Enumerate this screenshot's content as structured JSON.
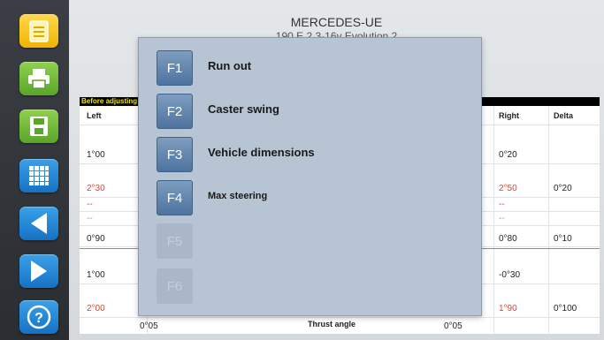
{
  "header": {
    "title": "MERCEDES-UE",
    "subtitle": "190 E 2.3-16v Evolution 2"
  },
  "sidebar": {
    "buttons": [
      {
        "icon": "notepad-icon",
        "color": "#f5c000"
      },
      {
        "icon": "printer-icon",
        "color": "#6ab83a"
      },
      {
        "icon": "save-icon",
        "color": "#6ab83a"
      },
      {
        "icon": "grid-icon",
        "color": "#1f86d6"
      },
      {
        "icon": "back-arrow-icon",
        "color": "#1f86d6"
      },
      {
        "icon": "forward-arrow-icon",
        "color": "#1f86d6"
      },
      {
        "icon": "help-icon",
        "color": "#1f86d6"
      }
    ]
  },
  "table": {
    "section_label": "Before adjusting",
    "col_left": "Left",
    "col_right": "Right",
    "col_delta": "Delta",
    "rows": {
      "r1_left": "1°00",
      "r1_right": "0°20",
      "r2_left": "2°30",
      "r2_right": "2°50",
      "r2_delta": "0°20",
      "r3_left": "--",
      "r3_right": "--",
      "r4_left": "--",
      "r4_right": "--",
      "r5_left": "0°90",
      "r5_right": "0°80",
      "r5_delta": "0°10",
      "r6_left": "1°00",
      "r6_right": "-0°30",
      "r7_left": "2°00",
      "r7_right": "1°90",
      "r7_delta": "0°100",
      "footer_left_value": "0°05",
      "footer_label": "Thrust angle",
      "footer_right_value": "0°05",
      "partial_c1": "(",
      "partial_c2": "(",
      "partial_c3": "(",
      "partial_r1": "-"
    }
  },
  "popup": {
    "items": [
      {
        "key": "F1",
        "label": "Run out",
        "enabled": true
      },
      {
        "key": "F2",
        "label": "Caster swing",
        "enabled": true
      },
      {
        "key": "F3",
        "label": "Vehicle dimensions",
        "enabled": true
      },
      {
        "key": "F4",
        "label": "Max steering",
        "enabled": true
      },
      {
        "key": "F5",
        "label": "",
        "enabled": false
      },
      {
        "key": "F6",
        "label": "",
        "enabled": false
      }
    ]
  }
}
